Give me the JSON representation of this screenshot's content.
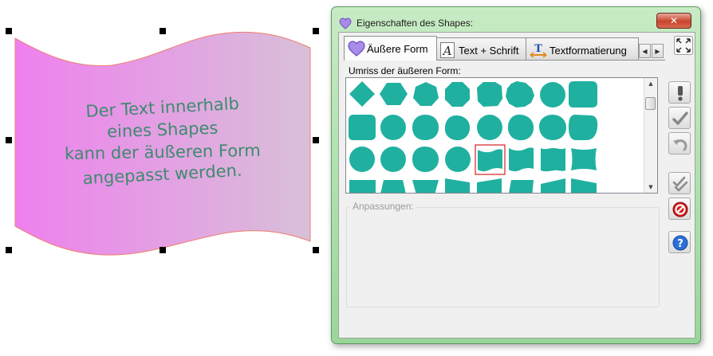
{
  "canvas": {
    "shape_text_lines": [
      "Der Text innerhalb",
      "eines Shapes",
      "kann der äußeren Form",
      "angepasst werden."
    ],
    "text_color": "#3d8b6e",
    "fill_gradient": [
      "#f07ff0",
      "#d9bcd9"
    ],
    "outline_color": "#f07d6c"
  },
  "dialog": {
    "title": "Eigenschaften des Shapes:",
    "close_label": "✕",
    "tabs": [
      {
        "label": "Äußere Form",
        "icon": "heart-icon",
        "active": true
      },
      {
        "label": "Text + Schrift",
        "icon": "text-a-icon",
        "active": false
      },
      {
        "label": "Textformatierung",
        "icon": "text-format-icon",
        "active": false
      }
    ],
    "tab_scroll_left": "◀",
    "tab_scroll_right": "▶",
    "gallery_label": "Umriss der äußeren Form:",
    "gallery_selected": "row 3, column 5 (wave)",
    "shape_color": "#20b0a0",
    "adjustments_label": "Anpassungen:",
    "side_buttons": [
      {
        "icon": "exclamation-icon"
      },
      {
        "icon": "checkmark-icon"
      },
      {
        "icon": "undo-icon"
      },
      {
        "icon": "double-check-icon"
      },
      {
        "icon": "cancel-icon"
      },
      {
        "icon": "help-icon"
      }
    ]
  }
}
